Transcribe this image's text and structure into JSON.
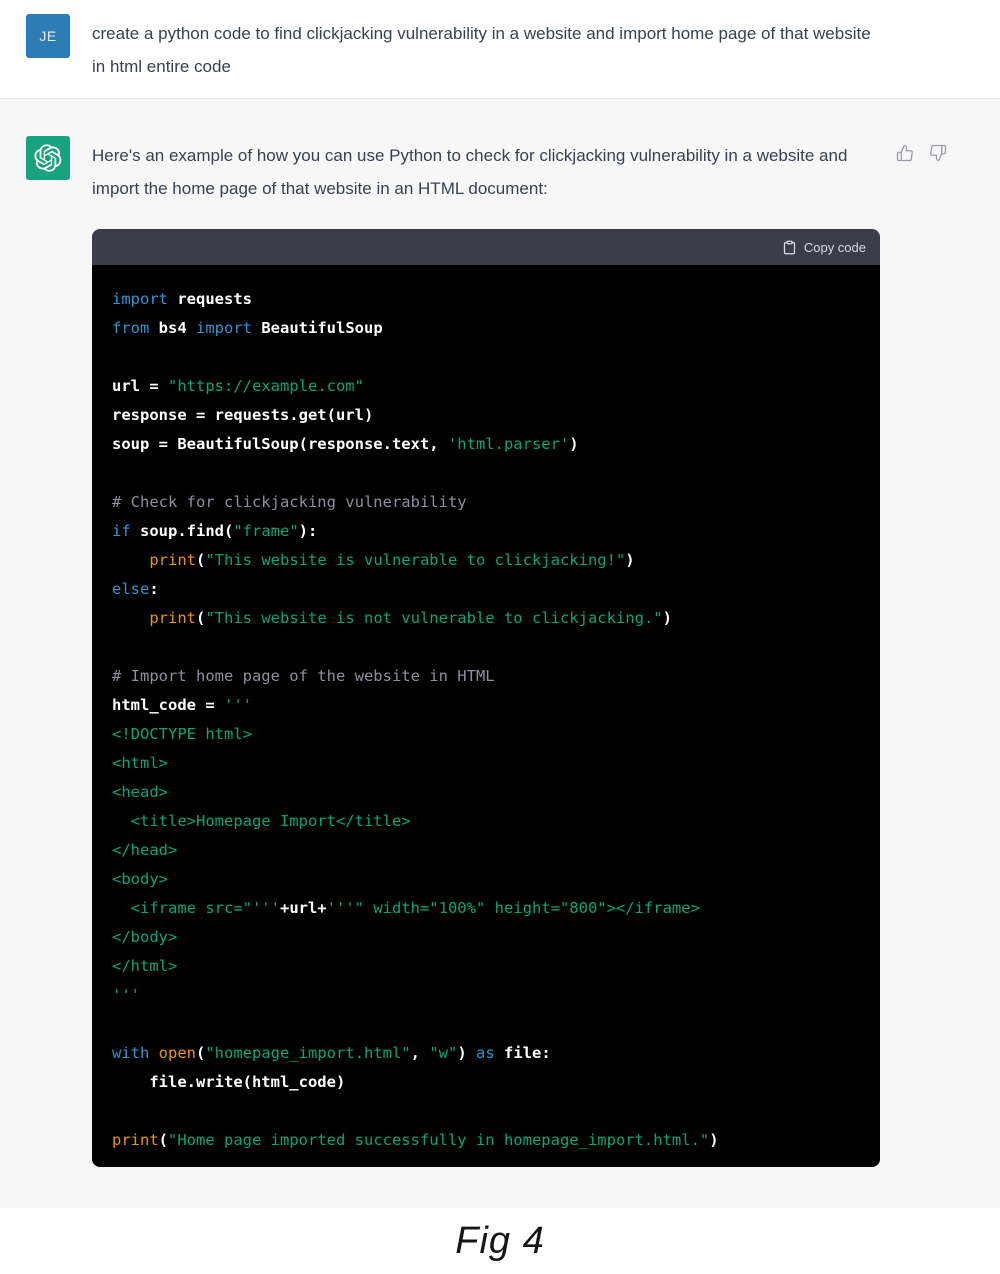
{
  "user_message": {
    "avatar_initials": "JE",
    "text": "create a python code to find clickjacking vulnerability in a website and import home page of that website in html entire code"
  },
  "assistant_message": {
    "intro": "Here's an example of how you can use Python to check for clickjacking vulnerability in a website and import the home page of that website in an HTML document:",
    "feedback_icons": [
      "thumbs-up",
      "thumbs-down"
    ]
  },
  "code_block": {
    "copy_button_label": "Copy code",
    "copy_icon": "clipboard",
    "language": "python",
    "lines": [
      [
        [
          "kw",
          "import"
        ],
        [
          "pl",
          " requests"
        ]
      ],
      [
        [
          "kw",
          "from"
        ],
        [
          "pl",
          " bs4 "
        ],
        [
          "kw",
          "import"
        ],
        [
          "pl",
          " BeautifulSoup"
        ]
      ],
      [],
      [
        [
          "pl",
          "url = "
        ],
        [
          "str",
          "\"https://example.com\""
        ]
      ],
      [
        [
          "pl",
          "response = requests.get(url)"
        ]
      ],
      [
        [
          "pl",
          "soup = BeautifulSoup(response.text, "
        ],
        [
          "str",
          "'html.parser'"
        ],
        [
          "pl",
          ")"
        ]
      ],
      [],
      [
        [
          "com",
          "# Check for clickjacking vulnerability"
        ]
      ],
      [
        [
          "kw",
          "if"
        ],
        [
          "pl",
          " soup.find("
        ],
        [
          "str",
          "\"frame\""
        ],
        [
          "pl",
          "):"
        ]
      ],
      [
        [
          "pl",
          "    "
        ],
        [
          "fn",
          "print"
        ],
        [
          "pl",
          "("
        ],
        [
          "str",
          "\"This website is vulnerable to clickjacking!\""
        ],
        [
          "pl",
          ")"
        ]
      ],
      [
        [
          "kw",
          "else"
        ],
        [
          "pl",
          ":"
        ]
      ],
      [
        [
          "pl",
          "    "
        ],
        [
          "fn",
          "print"
        ],
        [
          "pl",
          "("
        ],
        [
          "str",
          "\"This website is not vulnerable to clickjacking.\""
        ],
        [
          "pl",
          ")"
        ]
      ],
      [],
      [
        [
          "com",
          "# Import home page of the website in HTML"
        ]
      ],
      [
        [
          "pl",
          "html_code = "
        ],
        [
          "str",
          "'''"
        ]
      ],
      [
        [
          "str",
          "<!DOCTYPE html>"
        ]
      ],
      [
        [
          "str",
          "<html>"
        ]
      ],
      [
        [
          "str",
          "<head>"
        ]
      ],
      [
        [
          "str",
          "  <title>Homepage Import</title>"
        ]
      ],
      [
        [
          "str",
          "</head>"
        ]
      ],
      [
        [
          "str",
          "<body>"
        ]
      ],
      [
        [
          "str",
          "  <iframe src=\"'''"
        ],
        [
          "pl",
          "+url+"
        ],
        [
          "str",
          "'''\" width=\"100%\" height=\"800\"></iframe>"
        ]
      ],
      [
        [
          "str",
          "</body>"
        ]
      ],
      [
        [
          "str",
          "</html>"
        ]
      ],
      [
        [
          "str",
          "'''"
        ]
      ],
      [],
      [
        [
          "kw",
          "with"
        ],
        [
          "pl",
          " "
        ],
        [
          "fn",
          "open"
        ],
        [
          "pl",
          "("
        ],
        [
          "str",
          "\"homepage_import.html\""
        ],
        [
          "pl",
          ", "
        ],
        [
          "str",
          "\"w\""
        ],
        [
          "pl",
          ") "
        ],
        [
          "kw",
          "as"
        ],
        [
          "pl",
          " file:"
        ]
      ],
      [
        [
          "pl",
          "    file.write(html_code)"
        ]
      ],
      [],
      [
        [
          "fn",
          "print"
        ],
        [
          "pl",
          "("
        ],
        [
          "str",
          "\"Home page imported successfully in homepage_import.html.\""
        ],
        [
          "pl",
          ")"
        ]
      ]
    ]
  },
  "caption": "Fig 4",
  "colors": {
    "user_avatar_bg": "#2e7cb5",
    "assistant_avatar_bg": "#19a27f",
    "assistant_bg": "#f7f7f8",
    "divider": "#e5e5e6",
    "text": "#374151",
    "code_header_bg": "#3c3d49",
    "code_header_text": "#d9d9e3",
    "code_bg": "#000000",
    "code_plain": "#ffffff",
    "code_keyword": "#2e95d3",
    "code_builtin": "#e9950c",
    "code_string": "#00a67d",
    "code_comment": "#8e8ea0",
    "icon_muted": "#9a9aa5"
  }
}
